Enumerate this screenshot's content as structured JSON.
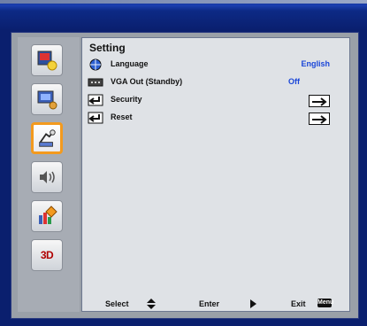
{
  "menu": {
    "title": "Setting",
    "items": [
      {
        "label": "Language",
        "value": "English",
        "icon": "globe-icon"
      },
      {
        "label": "VGA Out (Standby)",
        "value": "Off",
        "icon": "vga-port-icon"
      },
      {
        "label": "Security",
        "icon": "enter-icon",
        "control": "arrow-right-box"
      },
      {
        "label": "Reset",
        "icon": "enter-icon",
        "control": "arrow-right-box"
      }
    ]
  },
  "sidebar": {
    "items": [
      {
        "name": "image-settings"
      },
      {
        "name": "display-settings"
      },
      {
        "name": "setting",
        "active": true
      },
      {
        "name": "volume"
      },
      {
        "name": "options"
      },
      {
        "name": "3d-settings",
        "label": "3D"
      }
    ]
  },
  "footer": {
    "select_label": "Select",
    "enter_label": "Enter",
    "exit_label": "Exit",
    "menu_key_label": "Menu"
  },
  "colors": {
    "accent": "#f39a1e",
    "value_blue": "#1a46d8",
    "background": "#0a1f6e"
  }
}
